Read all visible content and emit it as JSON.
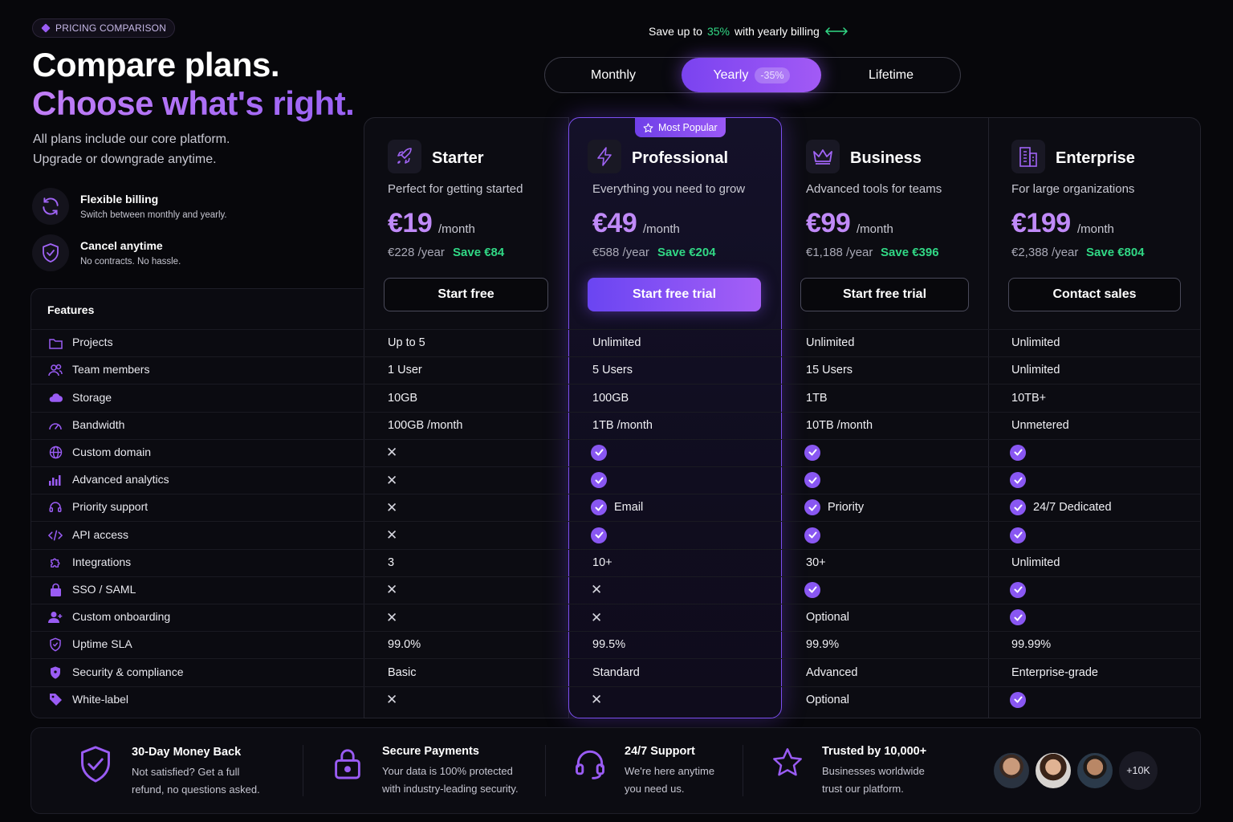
{
  "header": {
    "tag": "PRICING COMPARISON",
    "title_line1": "Compare plans.",
    "title_line2": "Choose what's right.",
    "subtitle_line1": "All plans include our core platform.",
    "subtitle_line2": "Upgrade or downgrade anytime.",
    "perks": [
      {
        "title": "Flexible billing",
        "desc": "Switch between monthly and yearly.",
        "icon": "refresh-icon"
      },
      {
        "title": "Cancel anytime",
        "desc": "No contracts. No hassle.",
        "icon": "shield-check-icon"
      }
    ]
  },
  "billing": {
    "save_prefix": "Save up to",
    "save_pct": "35%",
    "save_suffix": "with yearly billing",
    "options": [
      "Monthly",
      "Yearly",
      "Lifetime"
    ],
    "selected": "Yearly",
    "yearly_badge": "-35%"
  },
  "popular_badge": "Most Popular",
  "plans": [
    {
      "name": "Starter",
      "desc": "Perfect for getting started",
      "price": "€19",
      "per": "/month",
      "yearly": "€228 /year",
      "save": "Save €84",
      "cta": "Start free",
      "icon": "rocket-icon"
    },
    {
      "name": "Professional",
      "desc": "Everything you need to grow",
      "price": "€49",
      "per": "/month",
      "yearly": "€588 /year",
      "save": "Save €204",
      "cta": "Start free trial",
      "icon": "lightning-icon"
    },
    {
      "name": "Business",
      "desc": "Advanced tools for teams",
      "price": "€99",
      "per": "/month",
      "yearly": "€1,188 /year",
      "save": "Save €396",
      "cta": "Start free trial",
      "icon": "crown-icon"
    },
    {
      "name": "Enterprise",
      "desc": "For large organizations",
      "price": "€199",
      "per": "/month",
      "yearly": "€2,388 /year",
      "save": "Save €804",
      "cta": "Contact sales",
      "icon": "building-icon"
    }
  ],
  "features_header": "Features",
  "features": [
    {
      "name": "Projects",
      "icon": "folder-icon",
      "values": [
        "Up to 5",
        "Unlimited",
        "Unlimited",
        "Unlimited"
      ]
    },
    {
      "name": "Team members",
      "icon": "users-icon",
      "values": [
        "1 User",
        "5 Users",
        "15 Users",
        "Unlimited"
      ]
    },
    {
      "name": "Storage",
      "icon": "cloud-icon",
      "values": [
        "10GB",
        "100GB",
        "1TB",
        "10TB+"
      ]
    },
    {
      "name": "Bandwidth",
      "icon": "gauge-icon",
      "values": [
        "100GB /month",
        "1TB /month",
        "10TB /month",
        "Unmetered"
      ]
    },
    {
      "name": "Custom domain",
      "icon": "globe-icon",
      "values": [
        "x",
        "check",
        "check",
        "check"
      ]
    },
    {
      "name": "Advanced analytics",
      "icon": "analytics-icon",
      "values": [
        "x",
        "check",
        "check",
        "check"
      ]
    },
    {
      "name": "Priority support",
      "icon": "headset-icon",
      "values": [
        "x",
        "check:Email",
        "check:Priority",
        "check:24/7 Dedicated"
      ]
    },
    {
      "name": "API access",
      "icon": "code-icon",
      "values": [
        "x",
        "check",
        "check",
        "check"
      ]
    },
    {
      "name": "Integrations",
      "icon": "puzzle-icon",
      "values": [
        "3",
        "10+",
        "30+",
        "Unlimited"
      ]
    },
    {
      "name": "SSO / SAML",
      "icon": "lock-icon",
      "values": [
        "x",
        "x",
        "check",
        "check"
      ]
    },
    {
      "name": "Custom onboarding",
      "icon": "user-plus-icon",
      "values": [
        "x",
        "x",
        "Optional",
        "check"
      ]
    },
    {
      "name": "Uptime SLA",
      "icon": "shield-icon",
      "values": [
        "99.0%",
        "99.5%",
        "99.9%",
        "99.99%"
      ]
    },
    {
      "name": "Security & compliance",
      "icon": "security-shield-icon",
      "values": [
        "Basic",
        "Standard",
        "Advanced",
        "Enterprise-grade"
      ]
    },
    {
      "name": "White-label",
      "icon": "tag-icon",
      "values": [
        "x",
        "x",
        "Optional",
        "check"
      ]
    }
  ],
  "footer": {
    "items": [
      {
        "title": "30-Day Money Back",
        "line1": "Not satisfied? Get a full",
        "line2": "refund, no questions asked.",
        "icon": "shield-check-icon"
      },
      {
        "title": "Secure Payments",
        "line1": "Your data is 100% protected",
        "line2": "with industry-leading security.",
        "icon": "padlock-icon"
      },
      {
        "title": "24/7 Support",
        "line1": "We're here anytime",
        "line2": "you need us.",
        "icon": "headset-icon"
      },
      {
        "title": "Trusted by 10,000+",
        "line1": "Businesses worldwide",
        "line2": "trust our platform.",
        "icon": "star-icon"
      }
    ],
    "more_count": "+10K"
  },
  "colors": {
    "accent": "#9a5cf4",
    "green": "#31d885",
    "background": "#07070b"
  }
}
